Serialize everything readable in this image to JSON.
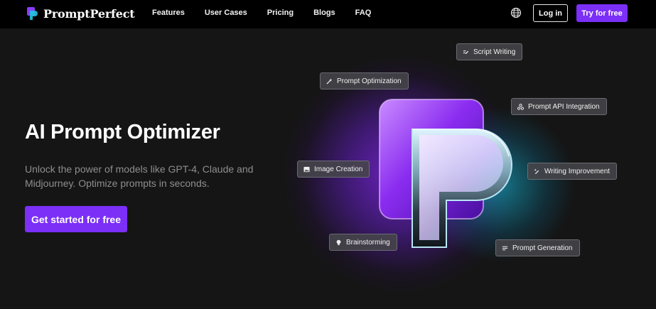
{
  "nav": {
    "brand": "PromptPerfect",
    "links": [
      "Features",
      "User Cases",
      "Pricing",
      "Blogs",
      "FAQ"
    ],
    "login_label": "Log in",
    "try_label": "Try for free"
  },
  "hero": {
    "title": "AI Prompt Optimizer",
    "subtitle": "Unlock the power of models like GPT-4, Claude and Midjourney. Optimize prompts in seconds.",
    "cta_label": "Get started for free"
  },
  "chips": {
    "script_writing": "Script Writing",
    "prompt_optimization": "Prompt Optimization",
    "prompt_api": "Prompt API Integration",
    "image_creation": "Image Creation",
    "writing_improvement": "Writing Improvement",
    "brainstorming": "Brainstorming",
    "prompt_generation": "Prompt Generation"
  },
  "colors": {
    "accent": "#7b2ff7",
    "nav_bg": "#000000",
    "page_bg": "#151515",
    "subtitle": "#8e8e8e",
    "chip_bg": "#46464a"
  },
  "icons": {
    "brand": "promptperfect-logo-icon",
    "language": "globe-icon",
    "script_writing": "pen-lines-icon",
    "prompt_optimization": "magic-wand-icon",
    "prompt_api": "nodes-icon",
    "image_creation": "image-icon",
    "writing_improvement": "sparkle-pen-icon",
    "brainstorming": "lightbulb-icon",
    "prompt_generation": "text-lines-icon"
  }
}
